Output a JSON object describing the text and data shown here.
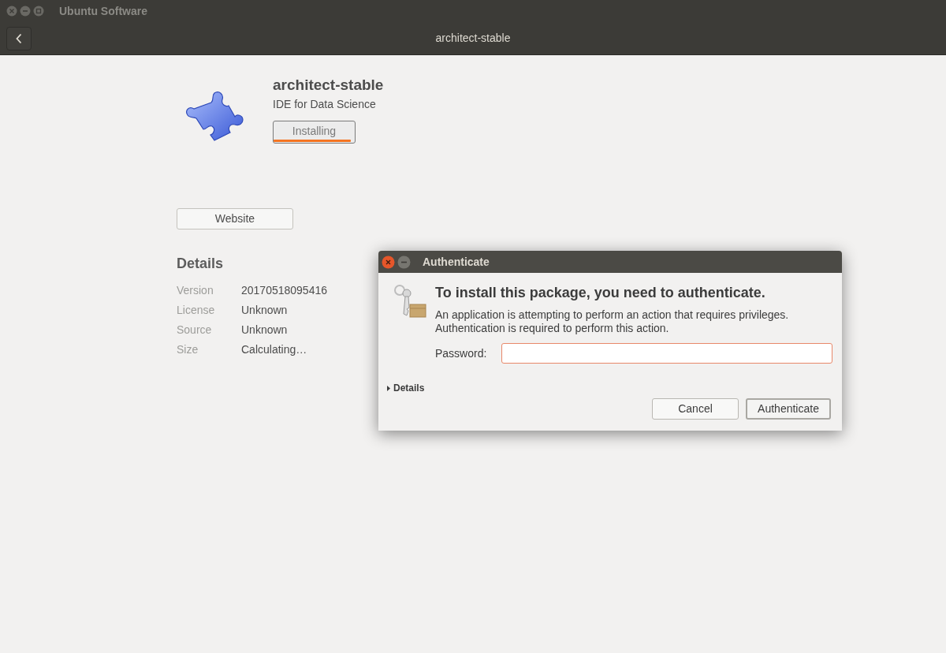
{
  "window": {
    "title": "Ubuntu Software"
  },
  "header": {
    "title": "architect-stable"
  },
  "app": {
    "name": "architect-stable",
    "summary": "IDE for Data Science",
    "install_button": {
      "label": "Installing",
      "level": 0.95
    },
    "website_button": "Website"
  },
  "details": {
    "heading": "Details",
    "rows": [
      {
        "label": "Version",
        "value": "20170518095416"
      },
      {
        "label": "License",
        "value": "Unknown"
      },
      {
        "label": "Source",
        "value": "Unknown"
      },
      {
        "label": "Size",
        "value": "Calculating…"
      }
    ]
  },
  "dialog": {
    "title": "Authenticate",
    "heading": "To install this package, you need to authenticate.",
    "message": "An application is attempting to perform an action that requires privileges. Authentication is required to perform this action.",
    "password_label": "Password:",
    "details": {
      "label": "Details",
      "expanded": false
    },
    "buttons": [
      "Cancel",
      "Authenticate"
    ]
  }
}
